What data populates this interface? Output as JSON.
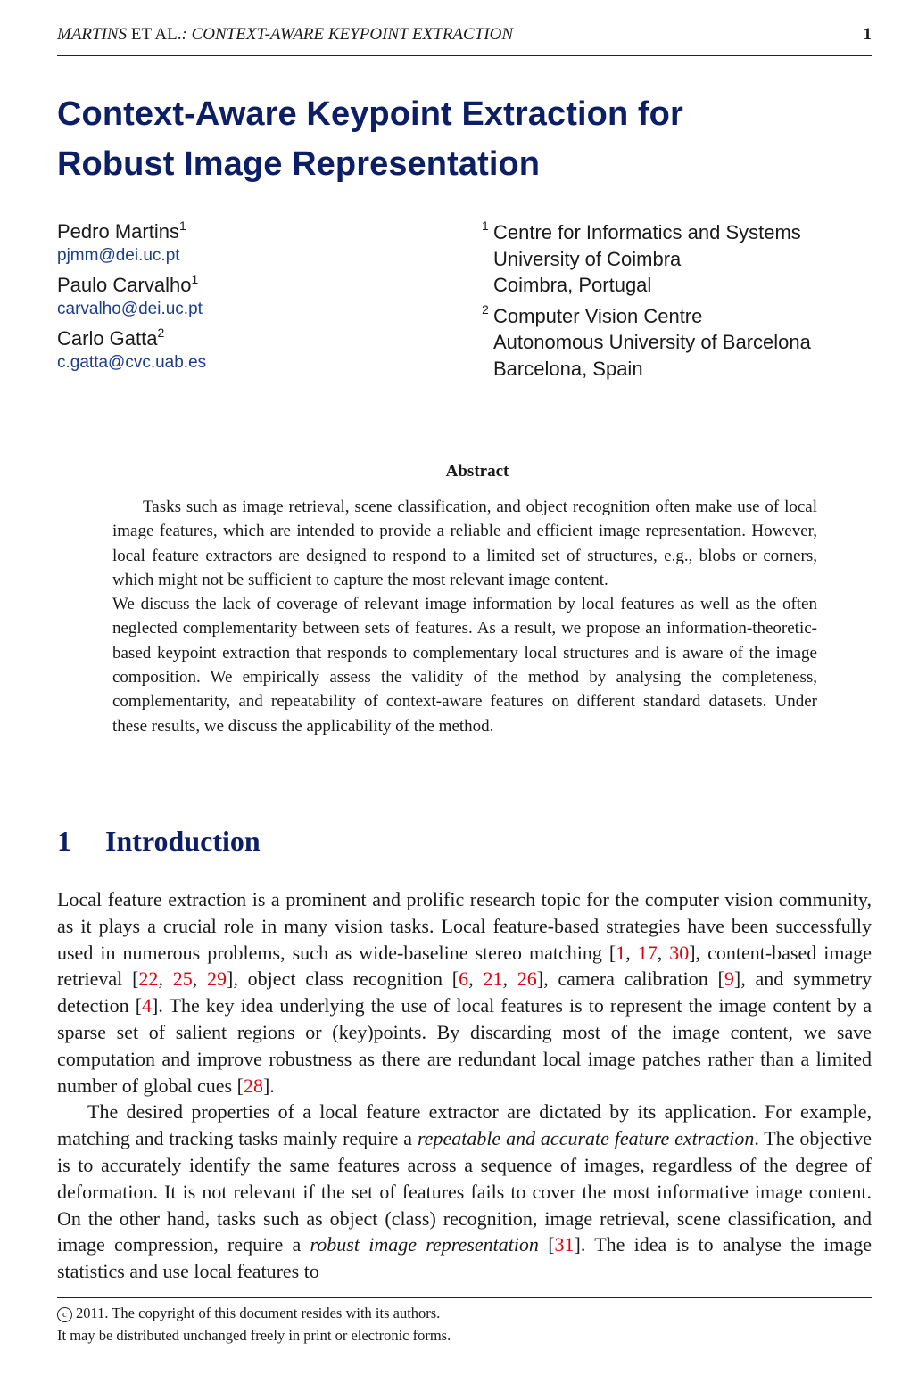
{
  "running_header": {
    "authors": "MARTINS",
    "et_al": " ET AL.",
    "separator": ": ",
    "short_title": "CONTEXT-AWARE KEYPOINT EXTRACTION",
    "page_number": "1"
  },
  "title": {
    "line1": "Context-Aware Keypoint Extraction for",
    "line2": "Robust Image Representation"
  },
  "authors": [
    {
      "name": "Pedro Martins",
      "affiliation_mark": "1",
      "email": "pjmm@dei.uc.pt"
    },
    {
      "name": "Paulo Carvalho",
      "affiliation_mark": "1",
      "email": "carvalho@dei.uc.pt"
    },
    {
      "name": "Carlo Gatta",
      "affiliation_mark": "2",
      "email": "c.gatta@cvc.uab.es"
    }
  ],
  "affiliations": [
    {
      "mark": "1",
      "lines": [
        "Centre for Informatics and Systems",
        "University of Coimbra",
        "Coimbra, Portugal"
      ]
    },
    {
      "mark": "2",
      "lines": [
        "Computer Vision Centre",
        "Autonomous University of Barcelona",
        "Barcelona, Spain"
      ]
    }
  ],
  "abstract": {
    "heading": "Abstract",
    "paragraphs": [
      "Tasks such as image retrieval, scene classification, and object recognition often make use of local image features, which are intended to provide a reliable and efficient image representation. However, local feature extractors are designed to respond to a limited set of structures, e.g., blobs or corners, which might not be sufficient to capture the most relevant image content.",
      "We discuss the lack of coverage of relevant image information by local features as well as the often neglected complementarity between sets of features. As a result, we propose an information-theoretic-based keypoint extraction that responds to complementary local structures and is aware of the image composition. We empirically assess the validity of the method by analysing the completeness, complementarity, and repeatability of context-aware features on different standard datasets. Under these results, we discuss the applicability of the method."
    ]
  },
  "section": {
    "number": "1",
    "title": "Introduction"
  },
  "body": {
    "p1": {
      "t1": "Local feature extraction is a prominent and prolific research topic for the computer vision community, as it plays a crucial role in many vision tasks.  Local feature-based strategies have been successfully used in numerous problems, such as wide-baseline stereo matching [",
      "c1": "1",
      "s1": ", ",
      "c2": "17",
      "s2": ", ",
      "c3": "30",
      "t2": "], content-based image retrieval [",
      "c4": "22",
      "s3": ", ",
      "c5": "25",
      "s4": ", ",
      "c6": "29",
      "t3": "], object class recognition [",
      "c7": "6",
      "s5": ", ",
      "c8": "21",
      "s6": ", ",
      "c9": "26",
      "t4": "], camera calibration [",
      "c10": "9",
      "t5": "], and symmetry detection [",
      "c11": "4",
      "t6": "]. The key idea underlying the use of local features is to represent the image content by a sparse set of salient regions or (key)points. By discarding most of the image content, we save computation and improve robustness as there are redundant local image patches rather than a limited number of global cues [",
      "c12": "28",
      "t7": "]."
    },
    "p2": {
      "t1": "The desired properties of a local feature extractor are dictated by its application.  For example, matching and tracking tasks mainly require a ",
      "e1": "repeatable and accurate feature extraction",
      "t2": ". The objective is to accurately identify the same features across a sequence of images, regardless of the degree of deformation. It is not relevant if the set of features fails to cover the most informative image content.  On the other hand, tasks such as object (class) recognition, image retrieval, scene classification, and image compression, require a ",
      "e2": "robust image representation",
      "t3": " [",
      "c1": "31",
      "t4": "]. The idea is to analyse the image statistics and use local features to"
    }
  },
  "footnote": {
    "copyright_symbol": "c",
    "line1": "2011. The copyright of this document resides with its authors.",
    "line2": "It may be distributed unchanged freely in print or electronic forms."
  },
  "colors": {
    "title": "#0c1f66",
    "email_link": "#1a3d8f",
    "citation": "#e1000f"
  }
}
